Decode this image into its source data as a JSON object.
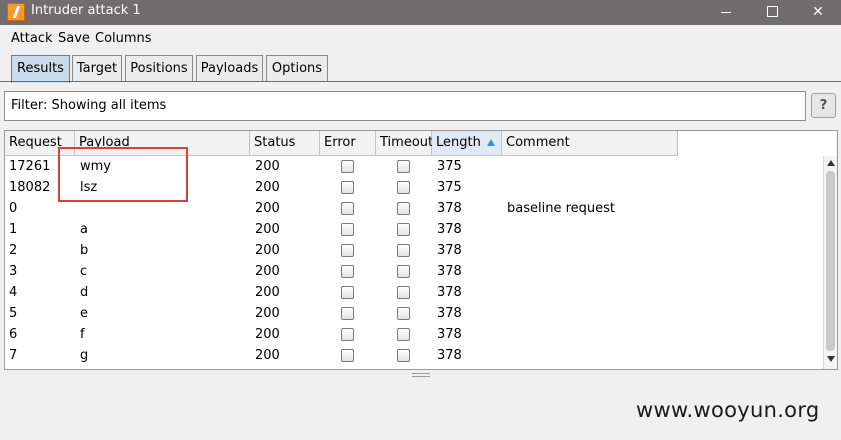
{
  "window": {
    "title": "Intruder attack 1",
    "icon": "burp-lightning-icon",
    "controls": [
      "minimize-icon",
      "maximize-icon",
      "close-icon"
    ]
  },
  "menu": [
    "Attack",
    "Save",
    "Columns"
  ],
  "tabs": [
    {
      "label": "Results",
      "active": true
    },
    {
      "label": "Target",
      "active": false
    },
    {
      "label": "Positions",
      "active": false
    },
    {
      "label": "Payloads",
      "active": false
    },
    {
      "label": "Options",
      "active": false
    }
  ],
  "filter": {
    "text": "Filter: Showing all items",
    "help_label": "?"
  },
  "table": {
    "columns": [
      "Request",
      "Payload",
      "Status",
      "Error",
      "Timeout",
      "Length",
      "Comment"
    ],
    "sorted_column": "Length",
    "sort_direction": "ascending",
    "rows": [
      {
        "request": "17261",
        "payload": "wmy",
        "status": "200",
        "error": false,
        "timeout": false,
        "length": "375",
        "comment": ""
      },
      {
        "request": "18082",
        "payload": "lsz",
        "status": "200",
        "error": false,
        "timeout": false,
        "length": "375",
        "comment": ""
      },
      {
        "request": "0",
        "payload": "",
        "status": "200",
        "error": false,
        "timeout": false,
        "length": "378",
        "comment": "baseline request"
      },
      {
        "request": "1",
        "payload": "a",
        "status": "200",
        "error": false,
        "timeout": false,
        "length": "378",
        "comment": ""
      },
      {
        "request": "2",
        "payload": "b",
        "status": "200",
        "error": false,
        "timeout": false,
        "length": "378",
        "comment": ""
      },
      {
        "request": "3",
        "payload": "c",
        "status": "200",
        "error": false,
        "timeout": false,
        "length": "378",
        "comment": ""
      },
      {
        "request": "4",
        "payload": "d",
        "status": "200",
        "error": false,
        "timeout": false,
        "length": "378",
        "comment": ""
      },
      {
        "request": "5",
        "payload": "e",
        "status": "200",
        "error": false,
        "timeout": false,
        "length": "378",
        "comment": ""
      },
      {
        "request": "6",
        "payload": "f",
        "status": "200",
        "error": false,
        "timeout": false,
        "length": "378",
        "comment": ""
      },
      {
        "request": "7",
        "payload": "g",
        "status": "200",
        "error": false,
        "timeout": false,
        "length": "378",
        "comment": ""
      }
    ]
  },
  "annotation": {
    "color": "#d9403a"
  },
  "watermark": "www.wooyun.org",
  "colors": {
    "titlebar": "#716c6d",
    "active_tab": "#c8dcec",
    "sort_arrow": "#4a8ac9"
  }
}
